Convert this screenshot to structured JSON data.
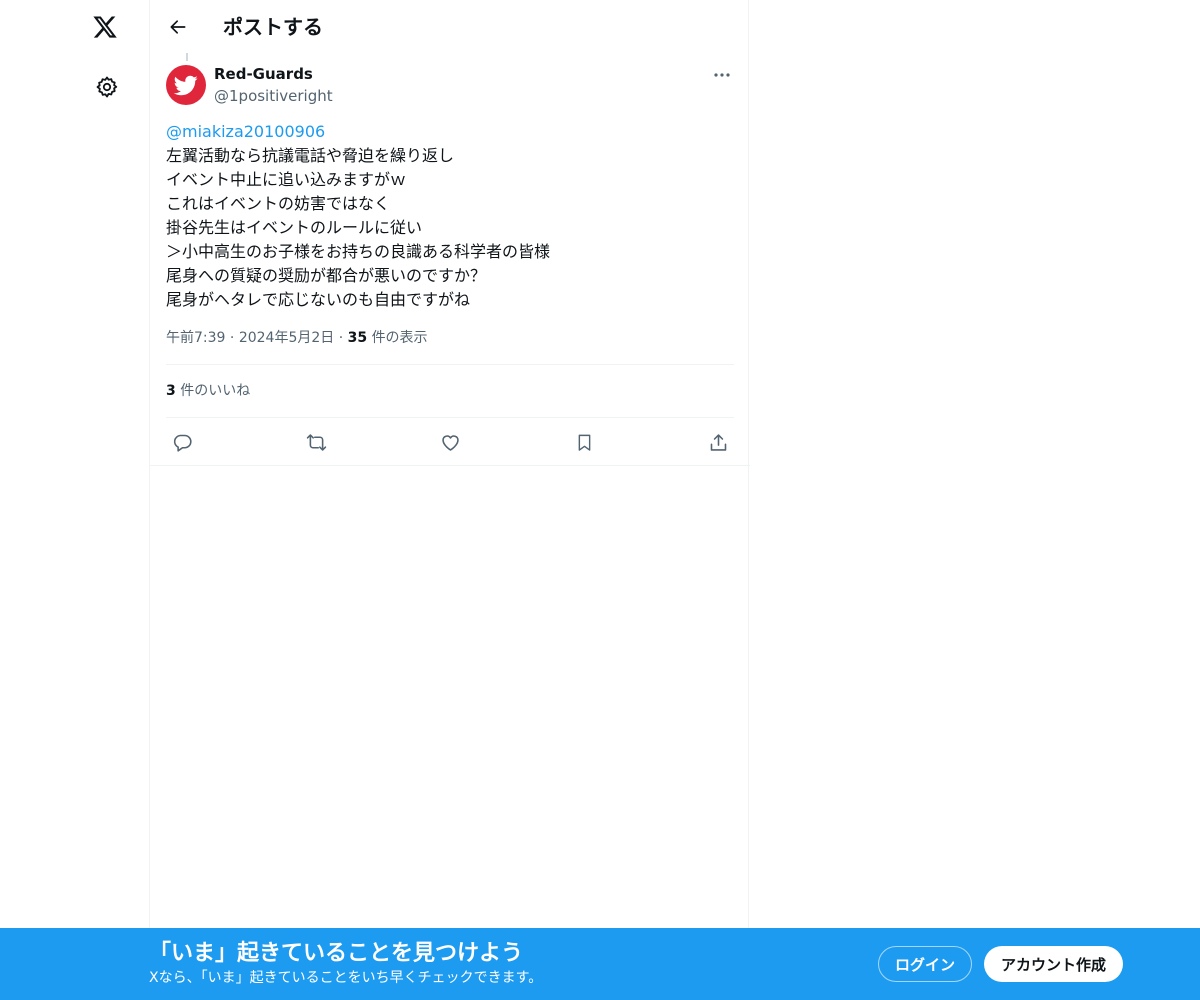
{
  "nav": {
    "logo_icon": "x-logo-icon",
    "settings_icon": "gear-icon"
  },
  "header": {
    "back_icon": "arrow-left-icon",
    "title": "ポストする"
  },
  "post": {
    "author_name": "Red-Guards",
    "author_handle": "@1positiveright",
    "avatar_icon": "bird-icon",
    "avatar_color": "#e0263a",
    "mention": "@miakiza20100906",
    "lines": [
      "左翼活動なら抗議電話や脅迫を繰り返し",
      "イベント中止に追い込みますがｗ",
      "これはイベントの妨害ではなく",
      "掛谷先生はイベントのルールに従い",
      "＞小中高生のお子様をお持ちの良識ある科学者の皆様",
      "尾身への質疑の奨励が都合が悪いのですか？",
      "尾身がヘタレで応じないのも自由ですがね"
    ],
    "time": "午前7:39",
    "date": "2024年5月2日",
    "views_count": "35",
    "views_label": "件の表示",
    "likes_count": "3",
    "likes_label": "件のいいね"
  },
  "actions": {
    "reply": "reply-icon",
    "repost": "repost-icon",
    "like": "heart-icon",
    "bookmark": "bookmark-icon",
    "share": "share-icon"
  },
  "banner": {
    "title": "「いま」起きていることを見つけよう",
    "subtitle": "Xなら、「いま」起きていることをいち早くチェックできます。",
    "login_label": "ログイン",
    "signup_label": "アカウント作成",
    "background": "#1d9bf0"
  },
  "colors": {
    "accent": "#1d9bf0",
    "text": "#0f1419",
    "secondary": "#536471"
  }
}
